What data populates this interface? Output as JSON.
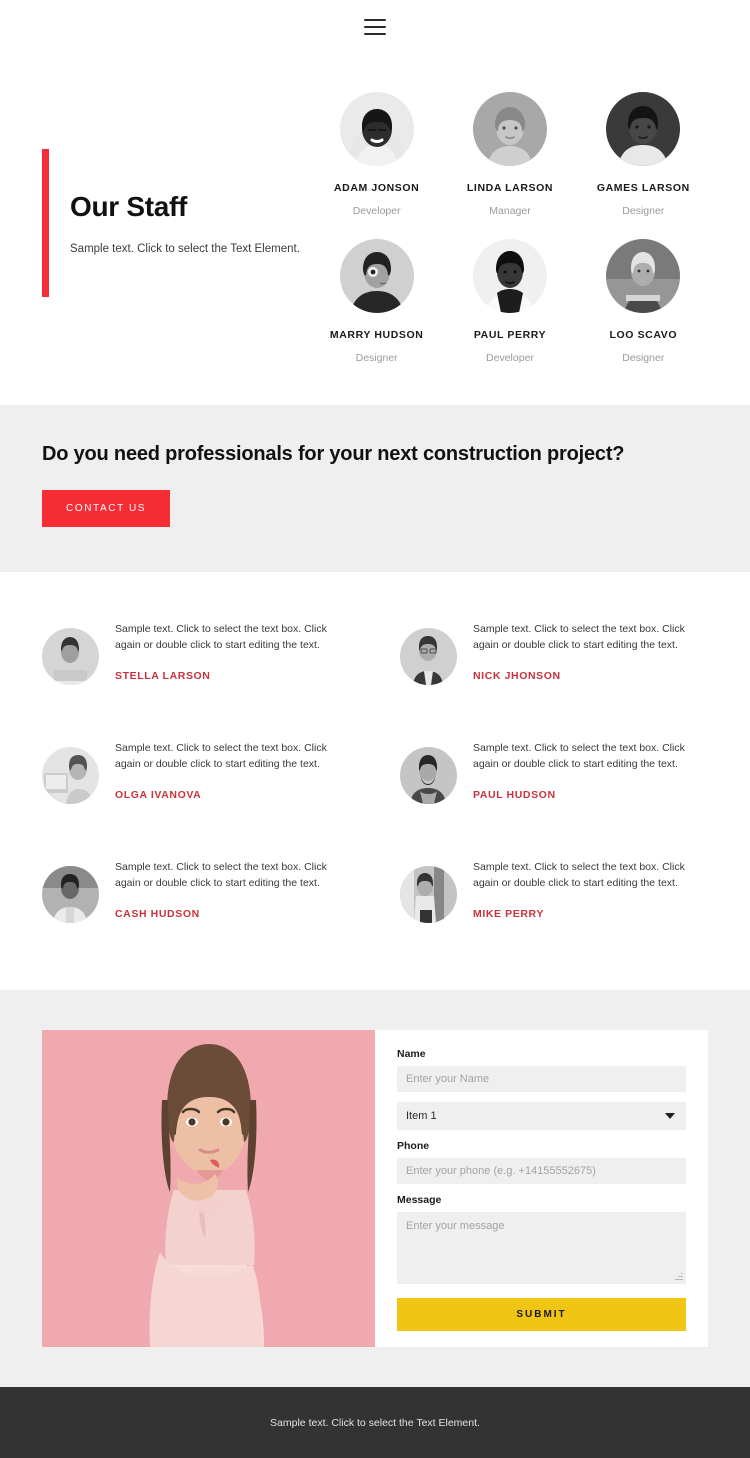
{
  "header": {
    "menu_icon": "hamburger-menu-icon"
  },
  "staff": {
    "heading": "Our Staff",
    "subtitle": "Sample text. Click to select the Text Element.",
    "accent_color": "#f62d35",
    "members": [
      {
        "name": "ADAM JONSON",
        "role": "Developer"
      },
      {
        "name": "LINDA LARSON",
        "role": "Manager"
      },
      {
        "name": "GAMES LARSON",
        "role": "Designer"
      },
      {
        "name": "MARRY HUDSON",
        "role": "Designer"
      },
      {
        "name": "PAUL PERRY",
        "role": "Developer"
      },
      {
        "name": "LOO SCAVO",
        "role": "Designer"
      }
    ]
  },
  "cta": {
    "heading": "Do you need professionals for your next construction project?",
    "button_label": "CONTACT US",
    "button_color": "#f62d35",
    "background_color": "#efefef"
  },
  "testimonials": {
    "name_color": "#c9323c",
    "items": [
      {
        "text": "Sample text. Click to select the text box. Click again or double click to start editing the text.",
        "name": "STELLA LARSON"
      },
      {
        "text": "Sample text. Click to select the text box. Click again or double click to start editing the text.",
        "name": "NICK JHONSON"
      },
      {
        "text": "Sample text. Click to select the text box. Click again or double click to start editing the text.",
        "name": "OLGA IVANOVA"
      },
      {
        "text": "Sample text. Click to select the text box. Click again or double click to start editing the text.",
        "name": "PAUL HUDSON"
      },
      {
        "text": "Sample text. Click to select the text box. Click again or double click to start editing the text.",
        "name": "CASH HUDSON"
      },
      {
        "text": "Sample text. Click to select the text box. Click again or double click to start editing the text.",
        "name": "MIKE PERRY"
      }
    ]
  },
  "contact": {
    "photo_background": "#f0a9ae",
    "name_label": "Name",
    "name_placeholder": "Enter your Name",
    "select_value": "Item 1",
    "select_options": [
      "Item 1"
    ],
    "phone_label": "Phone",
    "phone_placeholder": "Enter your phone (e.g. +14155552675)",
    "message_label": "Message",
    "message_placeholder": "Enter your message",
    "submit_label": "SUBMIT",
    "submit_color": "#f0c514"
  },
  "footer": {
    "text": "Sample text. Click to select the Text Element.",
    "background_color": "#333333"
  }
}
